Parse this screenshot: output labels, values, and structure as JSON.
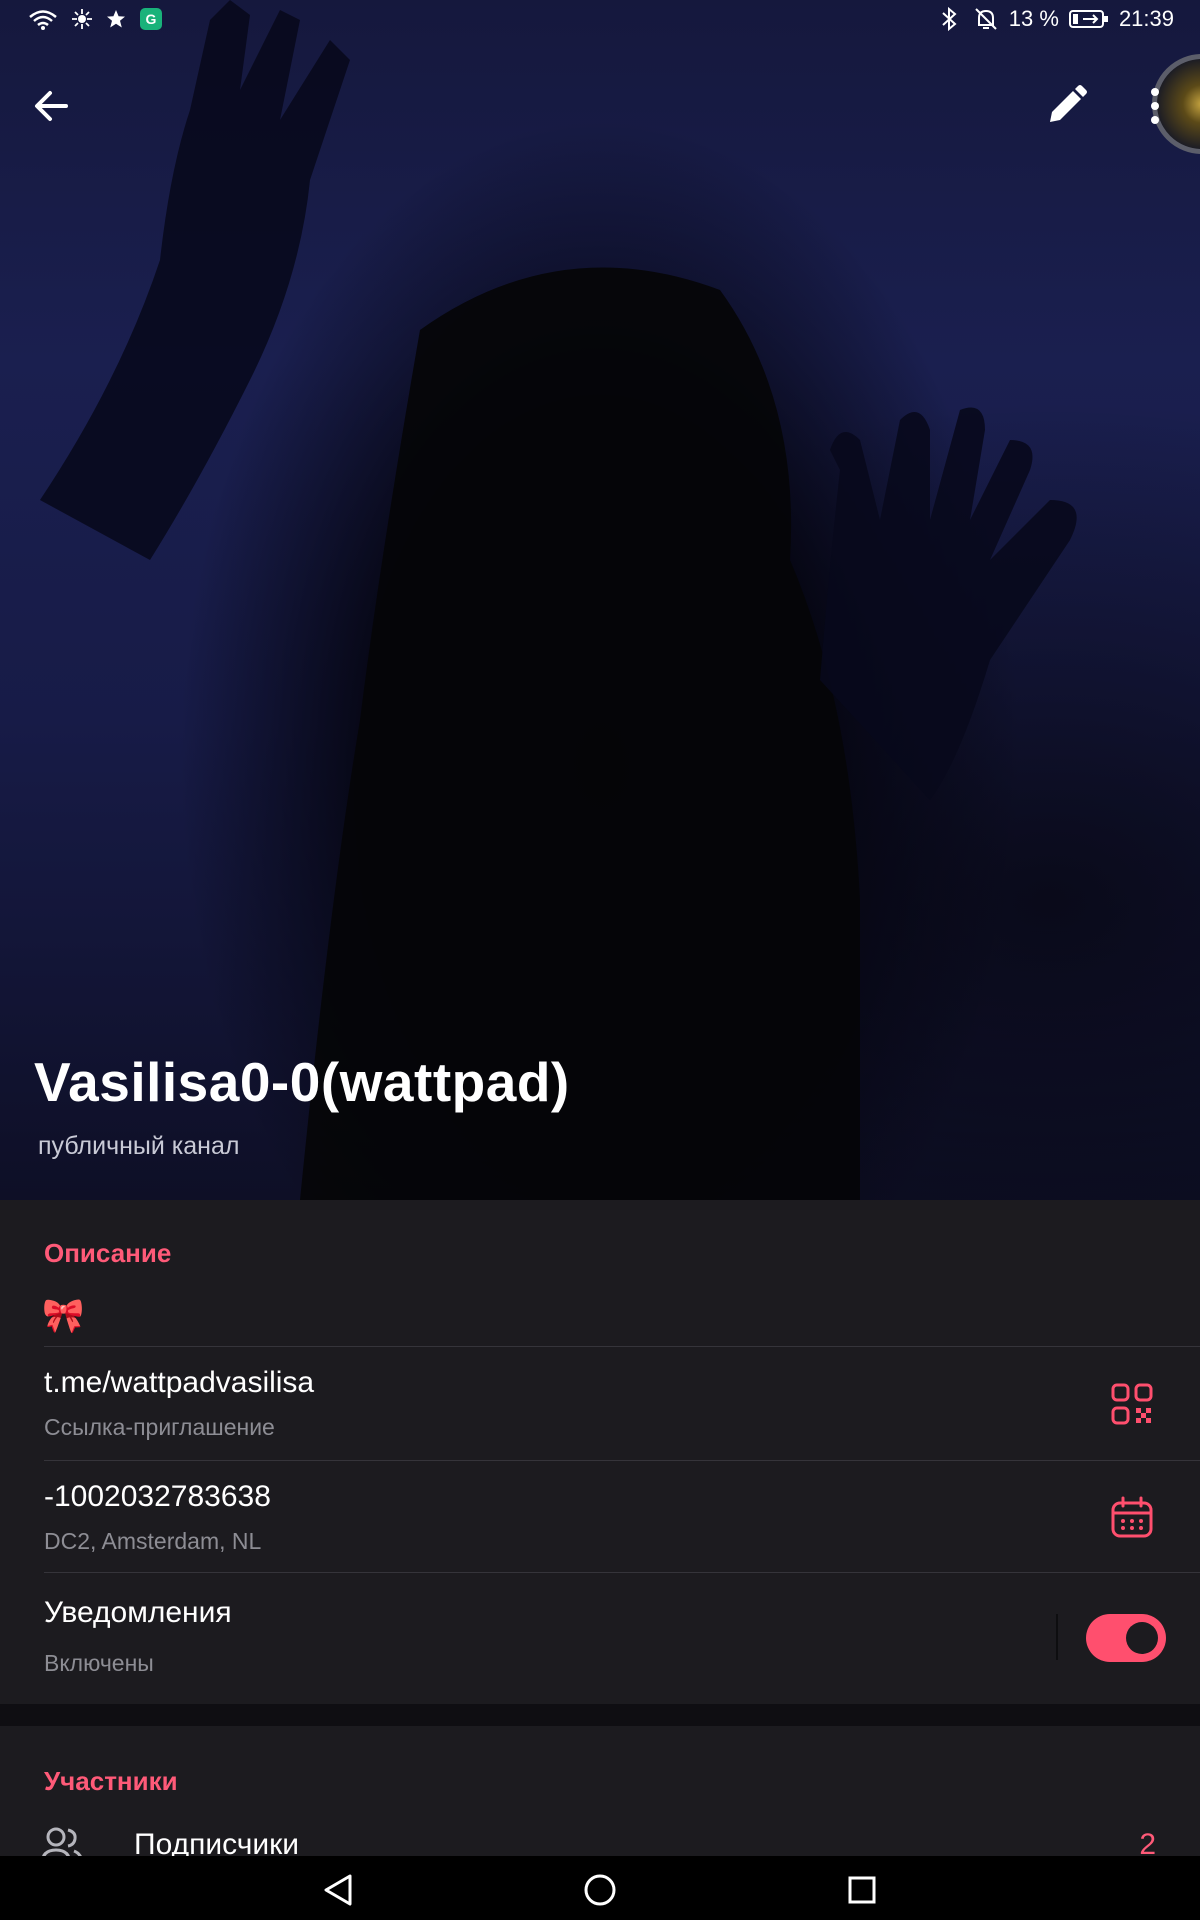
{
  "status_bar": {
    "battery_percent": "13 %",
    "time": "21:39",
    "app_badge": "G"
  },
  "header": {
    "title": "Vasilisa0-0(wattpad)",
    "subtitle": "публичный канал"
  },
  "description_section": {
    "heading": "Описание",
    "text": "🎀"
  },
  "invite_row": {
    "value": "t.me/wattpadvasilisa",
    "label": "Ссылка-приглашение",
    "icon": "qr-code-icon"
  },
  "id_row": {
    "value": "-1002032783638",
    "label": "DC2, Amsterdam, NL",
    "icon": "calendar-icon"
  },
  "notifications_row": {
    "title": "Уведомления",
    "label": "Включены",
    "enabled": true
  },
  "members_section": {
    "heading": "Участники",
    "subscribers_label": "Подписчики",
    "subscribers_count": "2"
  },
  "colors": {
    "accent": "#ff4f6e",
    "background": "#1c1b1f",
    "header_blue": "#1a1f4f"
  }
}
